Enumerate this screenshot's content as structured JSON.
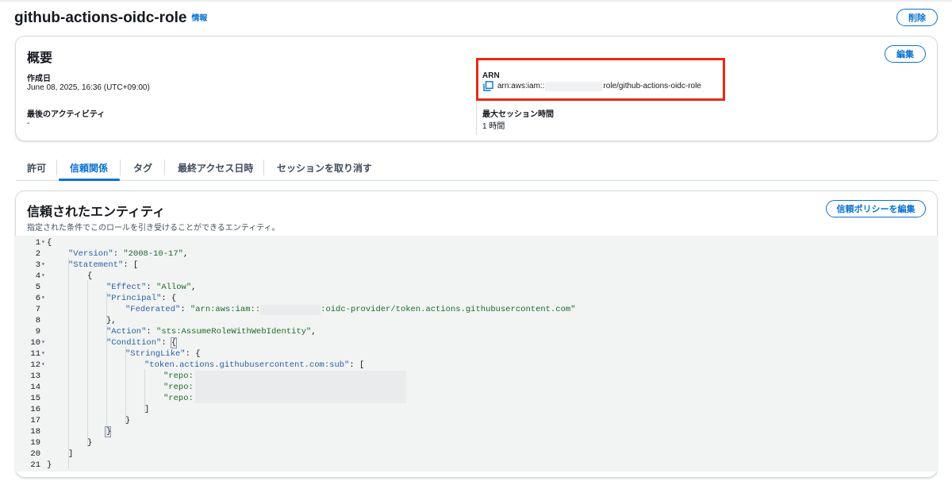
{
  "header": {
    "role_name": "github-actions-oidc-role",
    "info_label": "情報",
    "delete_label": "削除"
  },
  "summary": {
    "title": "概要",
    "edit_label": "編集",
    "created_label": "作成日",
    "created_value": "June 08, 2025, 16:36 (UTC+09:00)",
    "last_activity_label": "最後のアクティビティ",
    "last_activity_value": "-",
    "arn_label": "ARN",
    "arn_prefix": "arn:aws:iam::",
    "arn_suffix": "role/github-actions-oidc-role",
    "max_session_label": "最大セッション時間",
    "max_session_value": "1 時間",
    "highlight_color": "#ea2a0e"
  },
  "tabs": [
    {
      "label": "許可",
      "active": false
    },
    {
      "label": "信頼関係",
      "active": true
    },
    {
      "label": "タグ",
      "active": false
    },
    {
      "label": "最終アクセス日時",
      "active": false
    },
    {
      "label": "セッションを取り消す",
      "active": false
    }
  ],
  "trust": {
    "title": "信頼されたエンティティ",
    "subtitle": "指定された条件でこのロールを引き受けることができるエンティティ。",
    "edit_policy_label": "信頼ポリシーを編集"
  },
  "code_lines": [
    {
      "n": "1",
      "fold": true
    },
    {
      "n": "2",
      "fold": false
    },
    {
      "n": "3",
      "fold": true
    },
    {
      "n": "4",
      "fold": true
    },
    {
      "n": "5",
      "fold": false
    },
    {
      "n": "6",
      "fold": true
    },
    {
      "n": "7",
      "fold": false
    },
    {
      "n": "8",
      "fold": false
    },
    {
      "n": "9",
      "fold": false
    },
    {
      "n": "10",
      "fold": true
    },
    {
      "n": "11",
      "fold": true
    },
    {
      "n": "12",
      "fold": true
    },
    {
      "n": "13",
      "fold": false
    },
    {
      "n": "14",
      "fold": false
    },
    {
      "n": "15",
      "fold": false
    },
    {
      "n": "16",
      "fold": false
    },
    {
      "n": "17",
      "fold": false
    },
    {
      "n": "18",
      "fold": false
    },
    {
      "n": "19",
      "fold": false
    },
    {
      "n": "20",
      "fold": false
    },
    {
      "n": "21",
      "fold": false
    }
  ],
  "code": {
    "open_brace": "{",
    "close_brace": "}",
    "open_bracket": "[",
    "close_bracket": "]",
    "comma_brace": "},",
    "version_key": "\"Version\"",
    "version_value": "\"2008-10-17\"",
    "statement_key": "\"Statement\"",
    "effect_key": "\"Effect\"",
    "effect_value": "\"Allow\"",
    "principal_key": "\"Principal\"",
    "federated_key": "\"Federated\"",
    "federated_prefix": "\"arn:aws:iam::",
    "federated_suffix": ":oidc-provider/token.actions.githubusercontent.com\"",
    "action_key": "\"Action\"",
    "action_value": "\"sts:AssumeRoleWithWebIdentity\"",
    "condition_key": "\"Condition\"",
    "stringlike_key": "\"StringLike\"",
    "sub_key": "\"token.actions.githubusercontent.com:sub\"",
    "repo_prefix": "\"repo:"
  }
}
